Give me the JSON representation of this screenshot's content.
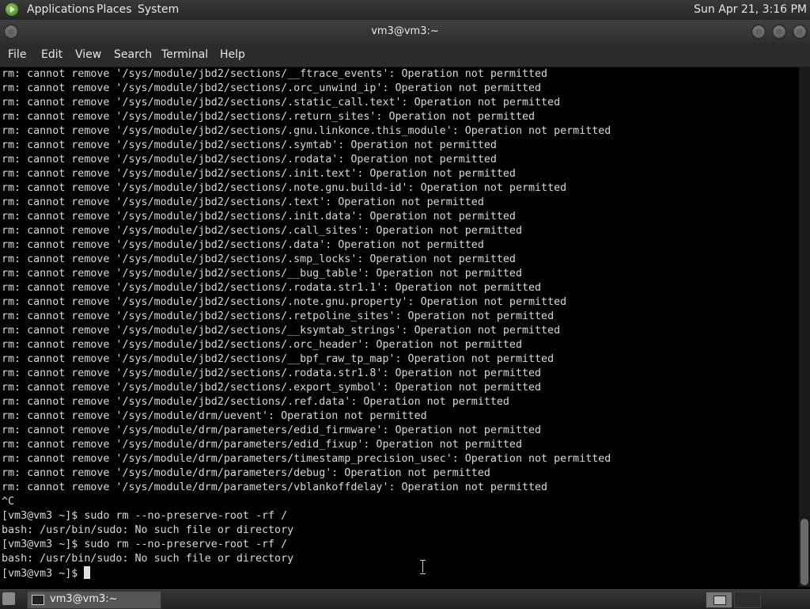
{
  "top_panel": {
    "menus": [
      "Applications",
      "Places",
      "System"
    ],
    "clock": "Sun Apr 21,  3:16 PM"
  },
  "window": {
    "title": "vm3@vm3:~"
  },
  "menubar": [
    "File",
    "Edit",
    "View",
    "Search",
    "Terminal",
    "Help"
  ],
  "terminal": {
    "lines": [
      "rm: cannot remove '/sys/module/jbd2/sections/__ftrace_events': Operation not permitted",
      "rm: cannot remove '/sys/module/jbd2/sections/.orc_unwind_ip': Operation not permitted",
      "rm: cannot remove '/sys/module/jbd2/sections/.static_call.text': Operation not permitted",
      "rm: cannot remove '/sys/module/jbd2/sections/.return_sites': Operation not permitted",
      "rm: cannot remove '/sys/module/jbd2/sections/.gnu.linkonce.this_module': Operation not permitted",
      "rm: cannot remove '/sys/module/jbd2/sections/.symtab': Operation not permitted",
      "rm: cannot remove '/sys/module/jbd2/sections/.rodata': Operation not permitted",
      "rm: cannot remove '/sys/module/jbd2/sections/.init.text': Operation not permitted",
      "rm: cannot remove '/sys/module/jbd2/sections/.note.gnu.build-id': Operation not permitted",
      "rm: cannot remove '/sys/module/jbd2/sections/.text': Operation not permitted",
      "rm: cannot remove '/sys/module/jbd2/sections/.init.data': Operation not permitted",
      "rm: cannot remove '/sys/module/jbd2/sections/.call_sites': Operation not permitted",
      "rm: cannot remove '/sys/module/jbd2/sections/.data': Operation not permitted",
      "rm: cannot remove '/sys/module/jbd2/sections/.smp_locks': Operation not permitted",
      "rm: cannot remove '/sys/module/jbd2/sections/__bug_table': Operation not permitted",
      "rm: cannot remove '/sys/module/jbd2/sections/.rodata.str1.1': Operation not permitted",
      "rm: cannot remove '/sys/module/jbd2/sections/.note.gnu.property': Operation not permitted",
      "rm: cannot remove '/sys/module/jbd2/sections/.retpoline_sites': Operation not permitted",
      "rm: cannot remove '/sys/module/jbd2/sections/__ksymtab_strings': Operation not permitted",
      "rm: cannot remove '/sys/module/jbd2/sections/.orc_header': Operation not permitted",
      "rm: cannot remove '/sys/module/jbd2/sections/__bpf_raw_tp_map': Operation not permitted",
      "rm: cannot remove '/sys/module/jbd2/sections/.rodata.str1.8': Operation not permitted",
      "rm: cannot remove '/sys/module/jbd2/sections/.export_symbol': Operation not permitted",
      "rm: cannot remove '/sys/module/jbd2/sections/.ref.data': Operation not permitted",
      "rm: cannot remove '/sys/module/drm/uevent': Operation not permitted",
      "rm: cannot remove '/sys/module/drm/parameters/edid_firmware': Operation not permitted",
      "rm: cannot remove '/sys/module/drm/parameters/edid_fixup': Operation not permitted",
      "rm: cannot remove '/sys/module/drm/parameters/timestamp_precision_usec': Operation not permitted",
      "rm: cannot remove '/sys/module/drm/parameters/debug': Operation not permitted",
      "rm: cannot remove '/sys/module/drm/parameters/vblankoffdelay': Operation not permitted",
      "^C",
      "[vm3@vm3 ~]$ sudo rm --no-preserve-root -rf /",
      "bash: /usr/bin/sudo: No such file or directory",
      "[vm3@vm3 ~]$ sudo rm --no-preserve-root -rf /",
      "bash: /usr/bin/sudo: No such file or directory"
    ],
    "prompt": "[vm3@vm3 ~]$"
  },
  "taskbar": {
    "task_label": "vm3@vm3:~"
  }
}
